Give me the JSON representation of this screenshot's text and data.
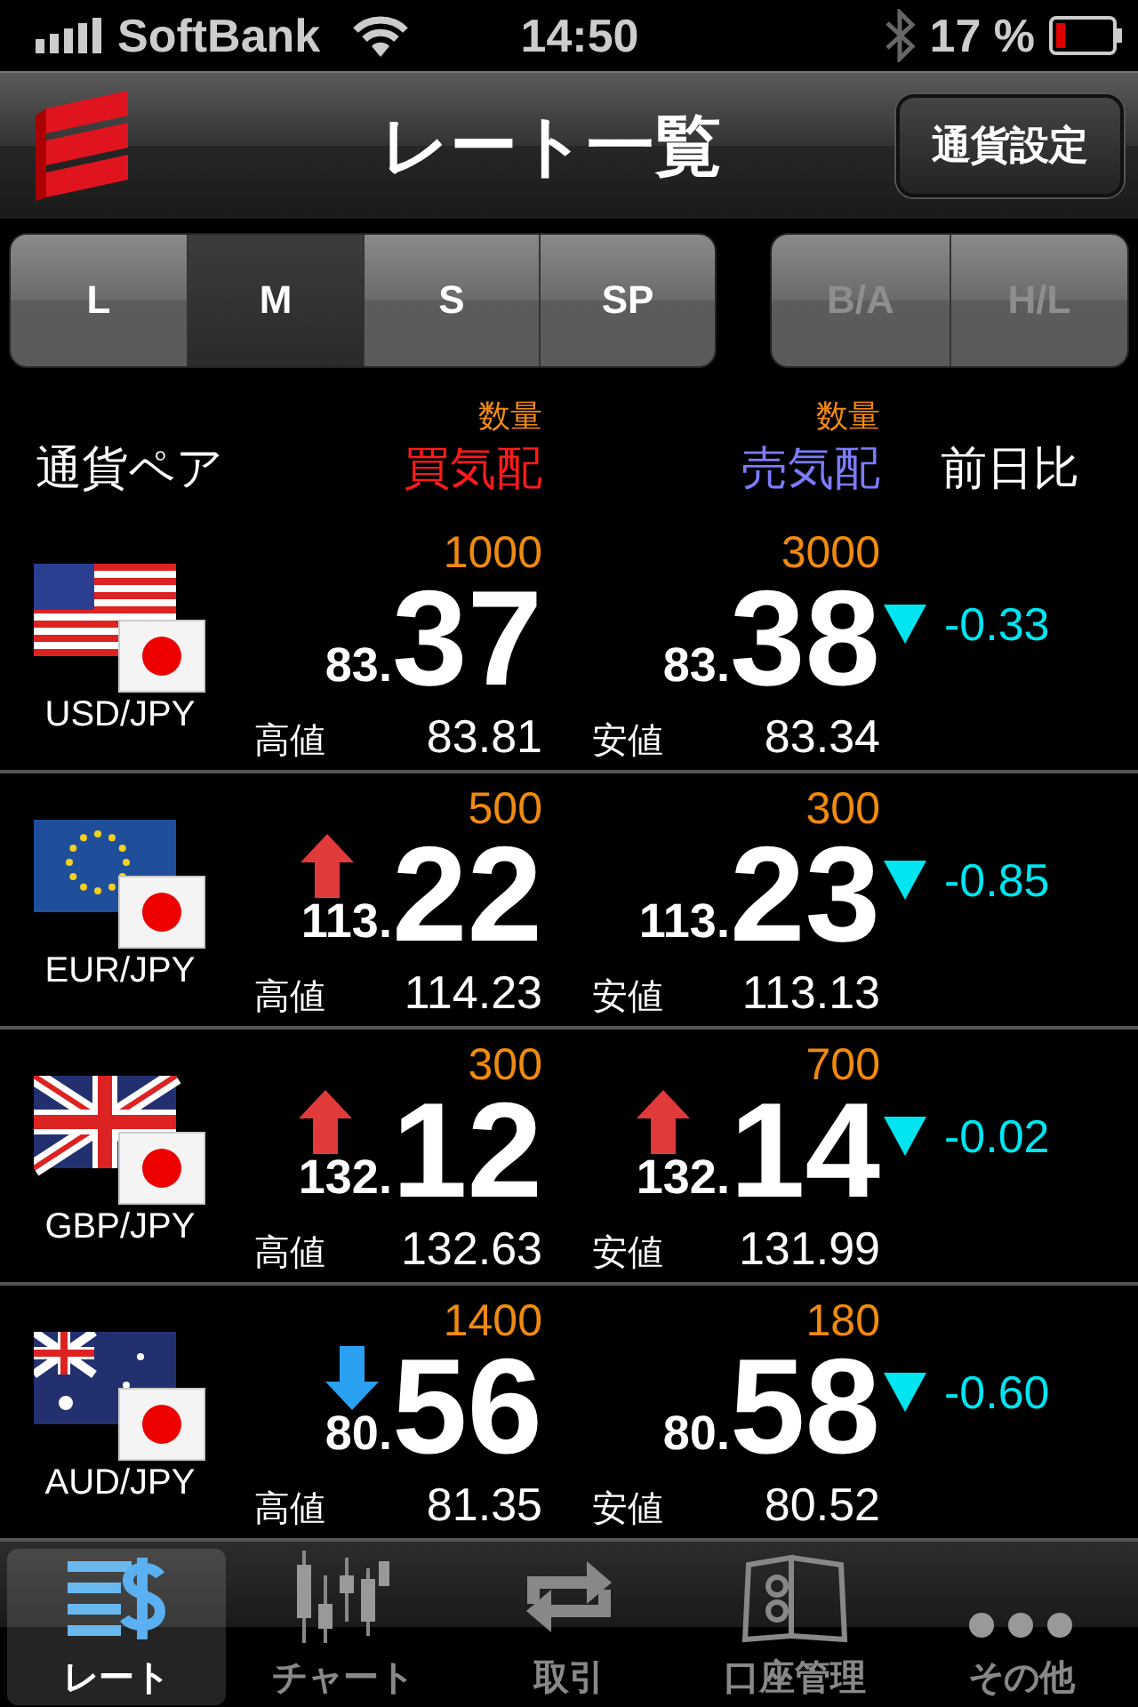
{
  "status_bar": {
    "carrier": "SoftBank",
    "time": "14:50",
    "battery": "17 %"
  },
  "nav_bar": {
    "title": "レート一覧",
    "button": "通貨設定"
  },
  "size_segments": [
    {
      "label": "L",
      "selected": false
    },
    {
      "label": "M",
      "selected": true
    },
    {
      "label": "S",
      "selected": false
    },
    {
      "label": "SP",
      "selected": false
    }
  ],
  "view_segments": [
    {
      "label": "B/A",
      "disabled": true
    },
    {
      "label": "H/L",
      "disabled": true
    }
  ],
  "header": {
    "pair": "通貨ペア",
    "bid_quantity": "数量",
    "bid": "買気配",
    "ask_quantity": "数量",
    "ask": "売気配",
    "change": "前日比"
  },
  "rows": [
    {
      "kind": "usd",
      "pair": "USD/JPY",
      "bid": {
        "quantity": "1000",
        "figure": "83.",
        "pips": "37",
        "rising": false,
        "falling": false,
        "label": "高値",
        "value": "83.81"
      },
      "ask": {
        "quantity": "3000",
        "figure": "83.",
        "pips": "38",
        "rising": false,
        "falling": false,
        "label": "安値",
        "value": "83.34"
      },
      "change": {
        "falling": true,
        "value": "-0.33"
      }
    },
    {
      "kind": "eur",
      "pair": "EUR/JPY",
      "bid": {
        "quantity": "500",
        "figure": "113.",
        "pips": "22",
        "rising": true,
        "falling": false,
        "label": "高値",
        "value": "114.23"
      },
      "ask": {
        "quantity": "300",
        "figure": "113.",
        "pips": "23",
        "rising": false,
        "falling": false,
        "label": "安値",
        "value": "113.13"
      },
      "change": {
        "falling": true,
        "value": "-0.85"
      }
    },
    {
      "kind": "gbp",
      "pair": "GBP/JPY",
      "bid": {
        "quantity": "300",
        "figure": "132.",
        "pips": "12",
        "rising": true,
        "falling": false,
        "label": "高値",
        "value": "132.63"
      },
      "ask": {
        "quantity": "700",
        "figure": "132.",
        "pips": "14",
        "rising": true,
        "falling": false,
        "label": "安値",
        "value": "131.99"
      },
      "change": {
        "falling": true,
        "value": "-0.02"
      }
    },
    {
      "kind": "aud",
      "pair": "AUD/JPY",
      "bid": {
        "quantity": "1400",
        "figure": "80.",
        "pips": "56",
        "rising": false,
        "falling": true,
        "label": "高値",
        "value": "81.35"
      },
      "ask": {
        "quantity": "180",
        "figure": "80.",
        "pips": "58",
        "rising": false,
        "falling": false,
        "label": "安値",
        "value": "80.52"
      },
      "change": {
        "falling": true,
        "value": "-0.60"
      }
    }
  ],
  "tab_bar": [
    {
      "kind": "rate",
      "label": "レート",
      "selected": true
    },
    {
      "kind": "chart",
      "label": "チャート",
      "selected": false
    },
    {
      "kind": "trade",
      "label": "取引",
      "selected": false
    },
    {
      "kind": "account",
      "label": "口座管理",
      "selected": false
    },
    {
      "kind": "more",
      "label": "その他",
      "selected": false
    }
  ]
}
